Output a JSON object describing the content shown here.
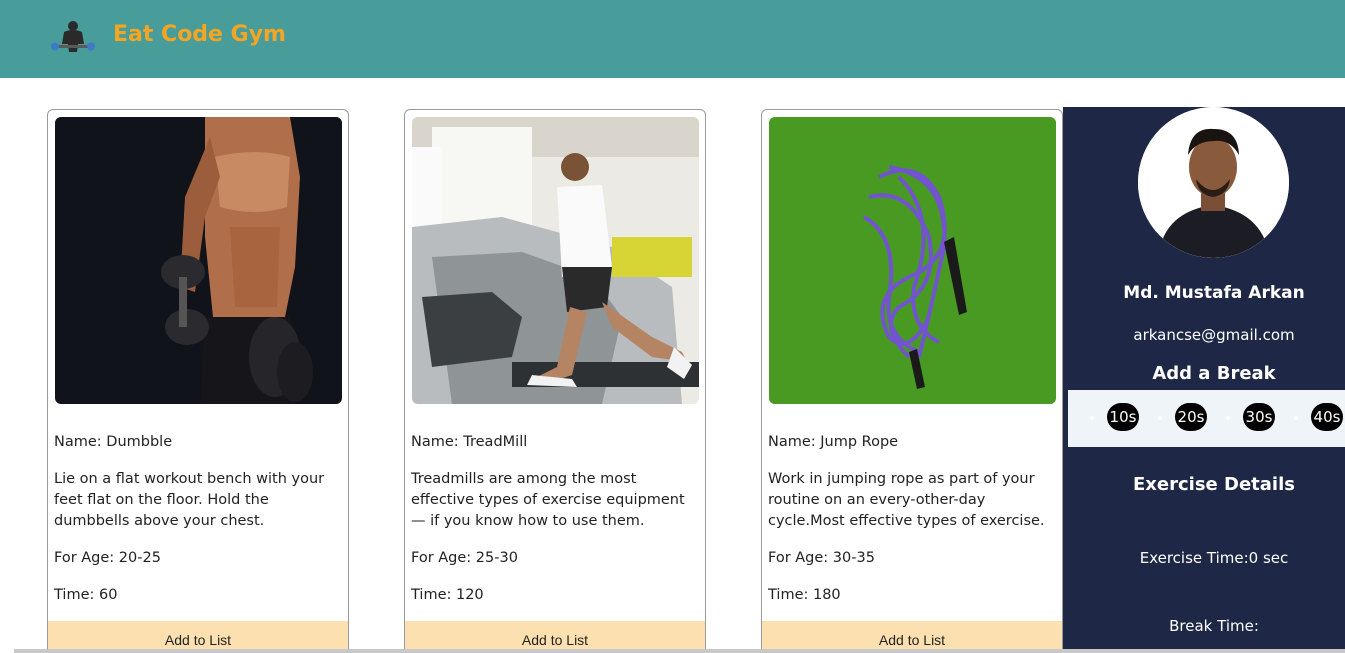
{
  "header": {
    "brand": "Eat Code Gym",
    "logo_icon": "gym-lifter-icon"
  },
  "cards": [
    {
      "image_icon": "dumbbell-athlete-image",
      "name": "Name: Dumbble",
      "description": "Lie on a flat workout bench with your feet flat on the floor. Hold the dumbbells above your chest.",
      "age": "For Age: 20-25",
      "time": "Time: 60",
      "button": "Add to List"
    },
    {
      "image_icon": "treadmill-runner-image",
      "name": "Name: TreadMill",
      "description": "Treadmills are among the most effective types of exercise equipment — if you know how to use them.",
      "age": "For Age: 25-30",
      "time": "Time: 120",
      "button": "Add to List"
    },
    {
      "image_icon": "jump-rope-image",
      "name": "Name: Jump Rope",
      "description": "Work in jumping rope as part of your routine on an every-other-day cycle.Most effective types of exercise.",
      "age": "For Age: 30-35",
      "time": "Time: 180",
      "button": "Add to List"
    }
  ],
  "sidebar": {
    "name": "Md. Mustafa Arkan",
    "email": "arkancse@gmail.com",
    "break_title": "Add a Break",
    "breaks": [
      "10s",
      "20s",
      "30s",
      "40s"
    ],
    "exercise_title": "Exercise Details",
    "exercise_time": "Exercise Time:0 sec",
    "break_time": "Break Time:"
  },
  "colors": {
    "header": "#489c9a",
    "brand": "#f4a522",
    "sidebar": "#1e2846",
    "button": "#fde0af"
  }
}
